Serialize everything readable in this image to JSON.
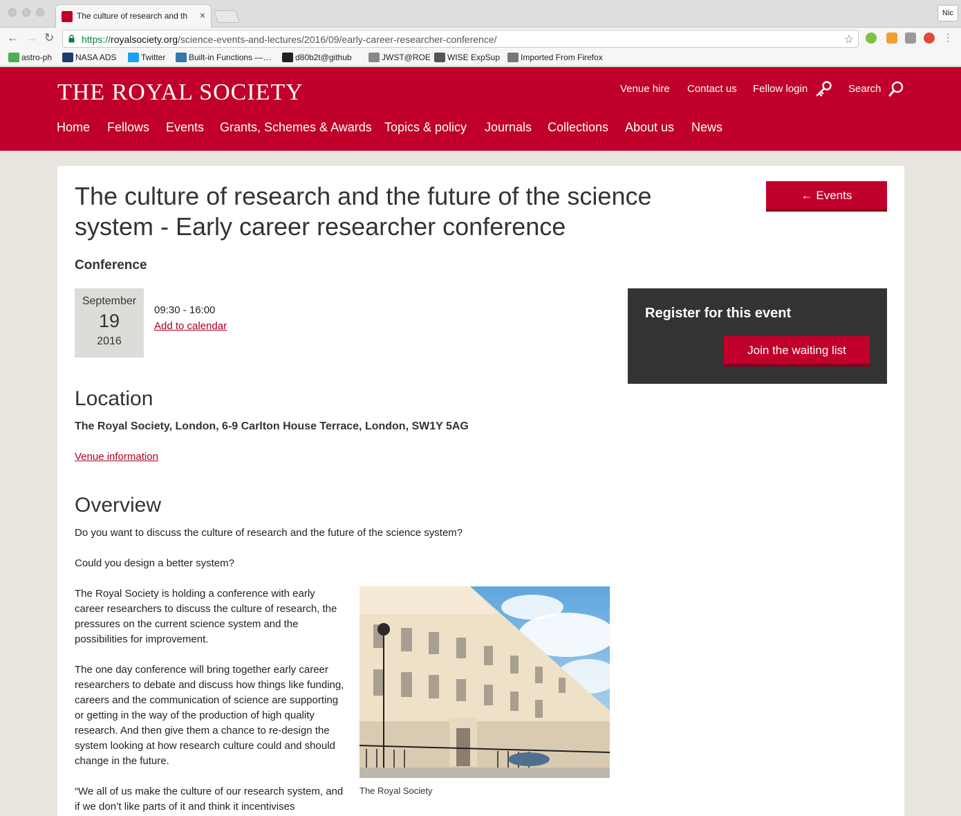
{
  "browser": {
    "tab_title": "The culture of research and th",
    "tab_close": "×",
    "profile": "Nic",
    "url_scheme": "https://",
    "url_host": "royalsociety.org",
    "url_path": "/science-events-and-lectures/2016/09/early-career-researcher-conference/",
    "bookmarks": [
      {
        "label": "astro-ph",
        "icon": "smiley-icon",
        "color": "#4caf50"
      },
      {
        "label": "NASA ADS",
        "icon": "ads-icon",
        "color": "#1e3c72"
      },
      {
        "label": "Twitter",
        "icon": "twitter-icon",
        "color": "#1da1f2"
      },
      {
        "label": "Built-in Functions —…",
        "icon": "python-icon",
        "color": "#3776ab"
      },
      {
        "label": "d80b2t@github",
        "icon": "github-icon",
        "color": "#222222"
      },
      {
        "label": "JWST@ROE",
        "icon": "page-icon",
        "color": "#888888"
      },
      {
        "label": "WISE ExpSup",
        "icon": "wise-icon",
        "color": "#555555"
      },
      {
        "label": "Imported From Firefox",
        "icon": "folder-icon",
        "color": "#777777"
      }
    ]
  },
  "site": {
    "logo": "THE ROYAL SOCIETY",
    "brand_color": "#c0002a",
    "utility": {
      "venue_hire": "Venue hire",
      "contact": "Contact us",
      "fellow_login": "Fellow login",
      "search": "Search"
    },
    "nav": [
      "Home",
      "Fellows",
      "Events",
      "Grants, Schemes & Awards",
      "Topics & policy",
      "Journals",
      "Collections",
      "About us",
      "News"
    ]
  },
  "event": {
    "title": "The culture of research and the future of the science system - Early career researcher conference",
    "back_label": "← Events",
    "type": "Conference",
    "date": {
      "month": "September",
      "day": "19",
      "year": "2016"
    },
    "time": "09:30 - 16:00",
    "calendar_link": "Add to calendar",
    "register": {
      "title": "Register for this event",
      "button": "Join the waiting list"
    },
    "location": {
      "heading": "Location",
      "address": "The Royal Society, London, 6-9 Carlton House Terrace, London, SW1Y 5AG",
      "venue_link": "Venue information"
    },
    "overview": {
      "heading": "Overview",
      "paragraphs": [
        "Do you want to discuss the culture of research and the future of the science system?",
        "Could you design a better system?",
        "The Royal Society is holding a conference with early career researchers to discuss the culture of research, the pressures on the current science system and the possibilities for improvement.",
        "The one day conference will bring together early career researchers to debate and discuss how things like funding, careers and the communication of science are supporting or getting in the way of the production of high quality research. And then give them a chance to re-design the system looking at how research culture could and should change in the future.",
        "“We all of us make the culture of our research system, and if we don’t like parts of it and think it incentivises"
      ],
      "image_caption": "The Royal Society"
    }
  }
}
